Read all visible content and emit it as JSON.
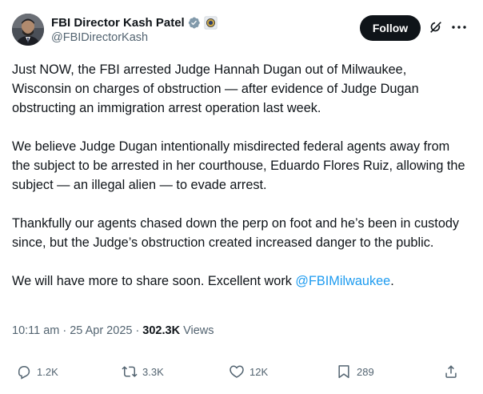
{
  "author": {
    "display_name": "FBI Director Kash Patel",
    "handle": "@FBIDirectorKash",
    "verified_badge_color": "#829aab",
    "avatar_icon": "profile-photo"
  },
  "follow_label": "Follow",
  "tweet": {
    "paragraphs": [
      "Just NOW, the FBI arrested Judge Hannah Dugan out of Milwaukee, Wisconsin on charges of obstruction — after evidence of Judge Dugan obstructing an immigration arrest operation last week.",
      "We believe Judge Dugan intentionally misdirected federal agents away from the subject to be arrested in her courthouse, Eduardo Flores Ruiz, allowing the subject — an illegal alien — to evade arrest.",
      "Thankfully our agents chased down the perp on foot and he’s been in custody since, but the Judge’s obstruction created increased danger to the public."
    ],
    "last_paragraph_text": "We will have more to share soon. Excellent work ",
    "last_paragraph_mention": "@FBIMilwaukee",
    "last_paragraph_end": "."
  },
  "meta": {
    "time": "10:11 am",
    "date": "25 Apr 2025",
    "views_count": "302.3K",
    "views_label": "Views",
    "separator": "·"
  },
  "actions": {
    "replies": "1.2K",
    "reposts": "3.3K",
    "likes": "12K",
    "bookmarks": "289"
  },
  "colors": {
    "text": "#0f1419",
    "secondary": "#536471",
    "link": "#1d9bf0",
    "button_bg": "#0f1419"
  }
}
